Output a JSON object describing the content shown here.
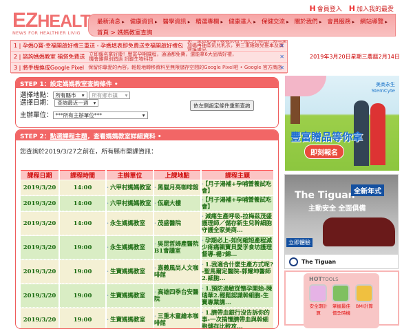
{
  "header": {
    "member_login": "會員登入",
    "add_favorite": "加入我的最愛",
    "logo_text": "EZHEALTH",
    "logo_tagline": "NEWS FOR HEALTHIER LIVIG"
  },
  "nav": {
    "items": [
      "最新消息",
      "健康資訊",
      "醫學資訊",
      "精選專欄",
      "健康達人",
      "保健交流",
      "關於我們",
      "會員服務",
      "網站導覽"
    ],
    "breadcrumb": [
      "首頁",
      "媽媽教室查詢"
    ]
  },
  "ads": [
    {
      "title": "1 | 孕媽Q寶-幸福開啟好禮三重送 - 孕媽填表即免費送幸福開啟好禮包",
      "desc": "第一重送奶嘴+袋裝奶粉+搖巴小鴨包，第二重加碼再抽蒸氣兒乳衣，第三重維跟兒推車及寶寶護膚品"
    },
    {
      "title": "2 | 諮詢媽媽教室 福袋免費送",
      "desc": "立即報名拿好康！豐富孕期課程，通通都免費，還能拿6大品牌好禮，機會難得別錯過 訊聯生物科技"
    },
    {
      "title": "3 | 將手機換成Google Pixel",
      "desc": "保留你專愛的內容，輕鬆地轉移資料至無限儲存空間的Google Pixel吧 • Google 官方商店"
    }
  ],
  "date": "2019年3月20日星期三農曆2月14日",
  "step1": {
    "title_prefix": "STEP 1：",
    "title": "設定媽媽教室查詢條件",
    "location_label": "選擇地點：",
    "city": "所有縣市",
    "town": "所有鄉市鎮",
    "date_label": "選擇日期：",
    "date_range": "查詢最近一週",
    "host_label": "主辦單位：",
    "host": "***所有主辦單位***",
    "submit": "依左側設定條件重新查詢"
  },
  "step2": {
    "title_prefix": "STEP 2：",
    "title": "點選課程主題",
    "title_suffix": "，查看媽媽教室詳細資料",
    "info": "您查詢於2019/3/27之前在，所有縣市開課資訊："
  },
  "table": {
    "headers": [
      "課程日期",
      "課程時間",
      "主辦單位",
      "上課地點",
      "課程主題"
    ],
    "rows": [
      [
        "2019/3/20",
        "14:00",
        "六甲村媽媽教室",
        "黑貓月亮咖啡館",
        "【月子湯補+孕哺營養試吃會】"
      ],
      [
        "2019/3/20",
        "14:00",
        "六甲村媽媽教室",
        "佤廟大樓",
        "【月子湯補+孕哺營養試吃會】"
      ],
      [
        "2019/3/20",
        "14:00",
        "永生媽媽教室",
        "茂盛醫院",
        "減痛生產呼吸-拉梅茲茂盛護理師／儲存新生兒幹細胞守護全家美商..."
      ],
      [
        "2019/3/20",
        "19:00",
        "永生媽媽教室",
        "吳昆哲婦產醫院B1會議室",
        "孕期必上-如何縮短產程減少疼痛親寶貝愛孚食坊護理督導-楊?錦..."
      ],
      [
        "2019/3/20",
        "19:00",
        "生寶媽媽教室",
        "嘉義風尚人文咖啡館",
        "1.我適合什麼生產方式呢?-聖馬爾定醫院-郭耀坤醫師2.細胞..."
      ],
      [
        "2019/3/20",
        "19:00",
        "生寶媽媽教室",
        "高雄四季台安醫院",
        "1.預防過敏從懷孕開始-陳瑞華2.輕鬆認識幹細胞-生寶專業講..."
      ],
      [
        "2019/3/20",
        "19:00",
        "生寶媽媽教室",
        "三重木童繪本咖啡館",
        "1.臍帶血銀行沒告訴你的事-一次搞懂臍帶血與幹細胞儲存比較攻..."
      ]
    ]
  },
  "side_ads": {
    "ad1_brand": "美商永生 StemCyte",
    "ad1_headline": "豐富贈品等你拿",
    "ad1_cta": "即刻報名",
    "ad2_title": "The Tiguan",
    "ad2_badge": "全新年式",
    "ad2_sub": "主動安全 全面俱備",
    "ad2_cta": "立即體驗",
    "ad2_footer": "The Tiguan"
  },
  "hottools": {
    "title_hot": "HOT",
    "title_tools": "TOOLS",
    "items": [
      "安全期計算",
      "掌握最佳懷孕時機",
      "BMI計算"
    ]
  }
}
